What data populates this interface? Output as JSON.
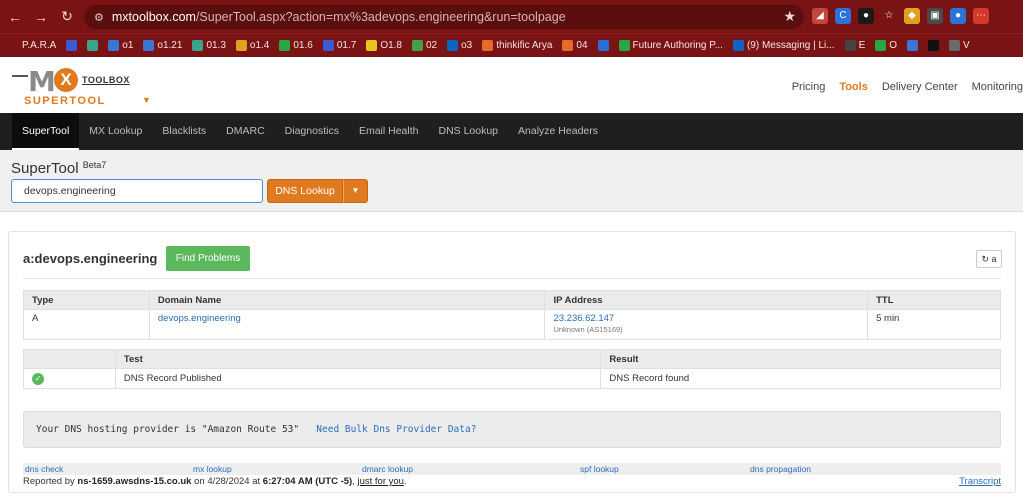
{
  "browser": {
    "url_host": "mxtoolbox.com",
    "url_path": "/SuperTool.aspx?action=mx%3adevops.engineering&run=toolpage",
    "bookmarks": [
      {
        "label": "P.A.R.A",
        "color": "#7a1414",
        "icon": "folder-icon"
      },
      {
        "label": "",
        "color": "#3b5bd6",
        "icon": "w-icon"
      },
      {
        "label": "",
        "color": "#3aa58a",
        "icon": "gpt-icon"
      },
      {
        "label": "o1",
        "color": "#3b76d6",
        "icon": "bookmark-icon"
      },
      {
        "label": "o1.21",
        "color": "#3b76d6",
        "icon": "bookmark-icon"
      },
      {
        "label": "01.3",
        "color": "#3aa58a",
        "icon": "gpt-icon"
      },
      {
        "label": "o1.4",
        "color": "#e0a020",
        "icon": "drive-icon"
      },
      {
        "label": "01.6",
        "color": "#27a844",
        "icon": "plus-icon"
      },
      {
        "label": "01.7",
        "color": "#3b5bd6",
        "icon": "w-icon"
      },
      {
        "label": "O1.8",
        "color": "#e6c51c",
        "icon": "m-icon"
      },
      {
        "label": "02",
        "color": "#43a047",
        "icon": "badge-icon"
      },
      {
        "label": "o3",
        "color": "#0a66c2",
        "icon": "linkedin-icon"
      },
      {
        "label": "thinkific Arya",
        "color": "#e46b2b",
        "icon": "gmail-icon"
      },
      {
        "label": "04",
        "color": "#e46b2b",
        "icon": "gmail-icon"
      },
      {
        "label": "",
        "color": "#2b6fd6",
        "icon": "shield-icon"
      },
      {
        "label": "Future Authoring P...",
        "color": "#27a844",
        "icon": "plus-icon"
      },
      {
        "label": "(9) Messaging | Li...",
        "color": "#0a66c2",
        "icon": "linkedin-icon"
      },
      {
        "label": "E",
        "color": "#444444",
        "icon": "box-icon"
      },
      {
        "label": "O",
        "color": "#27a844",
        "icon": "plus-icon"
      },
      {
        "label": "",
        "color": "#3b76d6",
        "icon": "app-icon"
      },
      {
        "label": "",
        "color": "#111111",
        "icon": "x-icon"
      },
      {
        "label": "V",
        "color": "#6a6a6a",
        "icon": "v-icon"
      }
    ]
  },
  "header": {
    "logo_toolbox": "TOOLBOX",
    "logo_supertool": "SUPERTOOL",
    "logo_mx": "M",
    "logo_x": "X",
    "nav": [
      "Pricing",
      "Tools",
      "Delivery Center",
      "Monitoring"
    ],
    "active_nav": "Tools"
  },
  "tool_tabs": [
    "SuperTool",
    "MX Lookup",
    "Blacklists",
    "DMARC",
    "Diagnostics",
    "Email Health",
    "DNS Lookup",
    "Analyze Headers"
  ],
  "search": {
    "title": "SuperTool",
    "version": "Beta7",
    "value": "devops.engineering",
    "button": "DNS Lookup"
  },
  "result": {
    "title": "a:devops.engineering",
    "find_button": "Find Problems",
    "refresh_label": "a",
    "records_headers": [
      "Type",
      "Domain Name",
      "IP Address",
      "TTL"
    ],
    "records": [
      {
        "type": "A",
        "domain": "devops.engineering",
        "ip": "23.236.62.147",
        "asn": "Unknown (AS15169)",
        "ttl": "5 min"
      }
    ],
    "tests_headers": [
      "",
      "Test",
      "Result"
    ],
    "tests": [
      {
        "status": "pass",
        "test": "DNS Record Published",
        "result": "DNS Record found"
      }
    ],
    "info_text": "Your DNS hosting provider is \"Amazon Route 53\"",
    "info_link": "Need Bulk Dns Provider Data?",
    "links": [
      "dns check",
      "mx lookup",
      "dmarc lookup",
      "spf lookup",
      "dns propagation"
    ],
    "reported_prefix": "Reported by",
    "reported_server": "ns-1659.awsdns-15.co.uk",
    "reported_on": "on 4/28/2024 at",
    "reported_time": "6:27:04 AM (UTC -5)",
    "reported_suffix": "just for you",
    "transcript": "Transcript"
  }
}
